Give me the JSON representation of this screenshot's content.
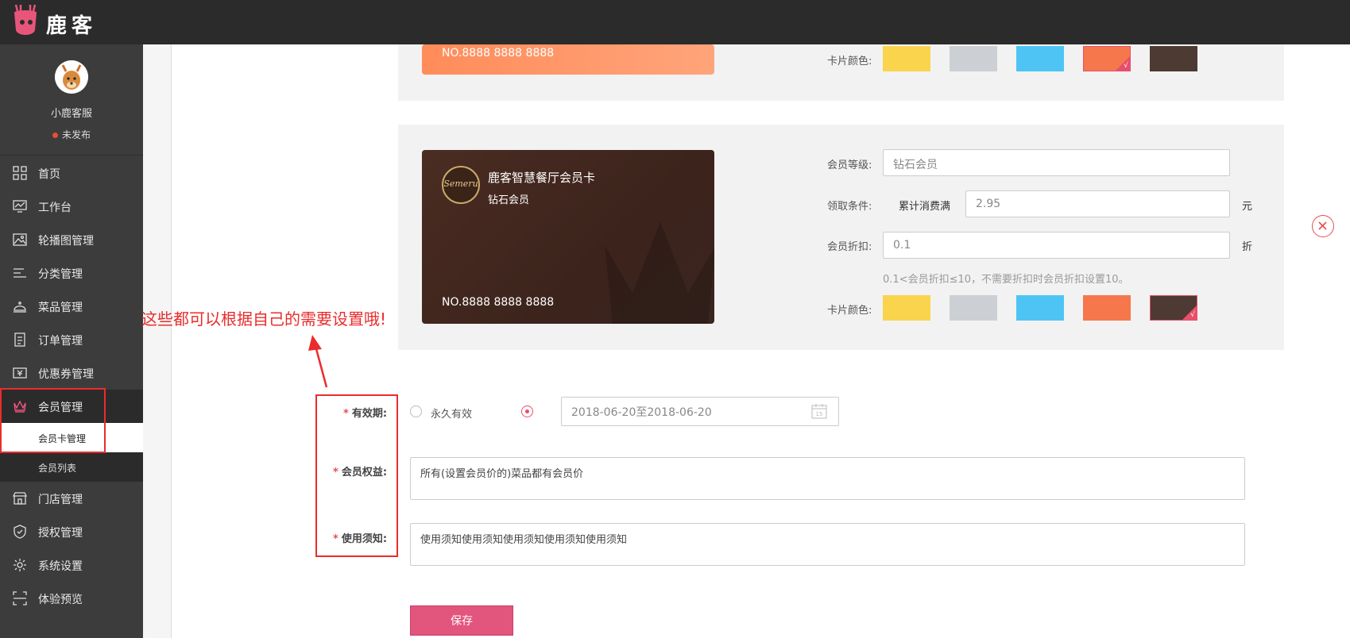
{
  "header": {
    "brand": "鹿客"
  },
  "sidebar": {
    "profile": {
      "name": "小鹿客服",
      "status": "未发布"
    },
    "items": [
      {
        "label": "首页",
        "icon": "grid-icon"
      },
      {
        "label": "工作台",
        "icon": "monitor-chart-icon"
      },
      {
        "label": "轮播图管理",
        "icon": "image-icon"
      },
      {
        "label": "分类管理",
        "icon": "list-icon"
      },
      {
        "label": "菜品管理",
        "icon": "cloche-icon"
      },
      {
        "label": "订单管理",
        "icon": "document-icon"
      },
      {
        "label": "优惠券管理",
        "icon": "coupon-icon"
      },
      {
        "label": "会员管理",
        "icon": "crown-icon"
      },
      {
        "label": "门店管理",
        "icon": "store-icon"
      },
      {
        "label": "授权管理",
        "icon": "shield-icon"
      },
      {
        "label": "系统设置",
        "icon": "gear-icon"
      },
      {
        "label": "体验预览",
        "icon": "scan-icon"
      }
    ],
    "subitems": [
      {
        "label": "会员卡管理"
      },
      {
        "label": "会员列表"
      }
    ]
  },
  "card_top": {
    "number": "NO.8888 8888 8888",
    "color_label": "卡片颜色:"
  },
  "card_main": {
    "shop_name": "鹿客智慧餐厅会员卡",
    "level": "钻石会员",
    "number": "NO.8888 8888 8888",
    "logo_text": "Semeru"
  },
  "form_card": {
    "level_label": "会员等级:",
    "level_value": "钻石会员",
    "condition_label": "领取条件:",
    "condition_type": "累计消费满",
    "condition_value": "2.95",
    "condition_unit": "元",
    "discount_label": "会员折扣:",
    "discount_value": "0.1",
    "discount_unit": "折",
    "discount_hint": "0.1<会员折扣≤10，不需要折扣时会员折扣设置10。",
    "color_label": "卡片颜色:"
  },
  "swatch_colors": [
    "#fbd44e",
    "#ccd0d4",
    "#4ec4f5",
    "#f6774c",
    "#4d3a33"
  ],
  "form_main": {
    "validity_label": "有效期:",
    "validity_option_permanent": "永久有效",
    "validity_range": "2018-06-20至2018-06-20",
    "benefits_label": "会员权益:",
    "benefits_value": "所有(设置会员价的)菜品都有会员价",
    "notice_label": "使用须知:",
    "notice_value": "使用须知使用须知使用须知使用须知使用须知",
    "save_label": "保存"
  },
  "annotation": {
    "text": "这些都可以根据自己的需要设置哦!"
  }
}
